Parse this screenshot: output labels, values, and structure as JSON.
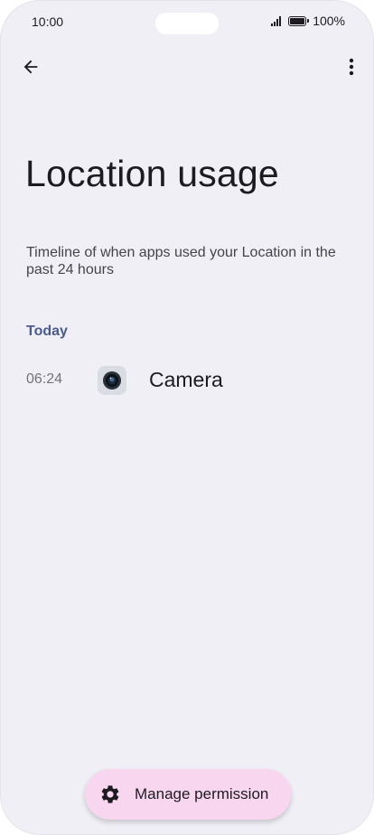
{
  "status_bar": {
    "time": "10:00",
    "battery": "100%"
  },
  "toolbar": {
    "back_icon": "arrow-back-icon",
    "more_icon": "more-vert-icon"
  },
  "page": {
    "title": "Location usage",
    "description": "Timeline of when apps used your Location in the past 24 hours"
  },
  "timeline": {
    "sections": [
      {
        "header": "Today",
        "entries": [
          {
            "time": "06:24",
            "app_name": "Camera",
            "icon": "camera-app-icon"
          }
        ]
      }
    ]
  },
  "fab": {
    "label": "Manage permission",
    "icon": "gear-icon"
  },
  "colors": {
    "background": "#f0eff6",
    "section_header": "#4a5b8c",
    "fab_background": "#f9d6f0"
  }
}
